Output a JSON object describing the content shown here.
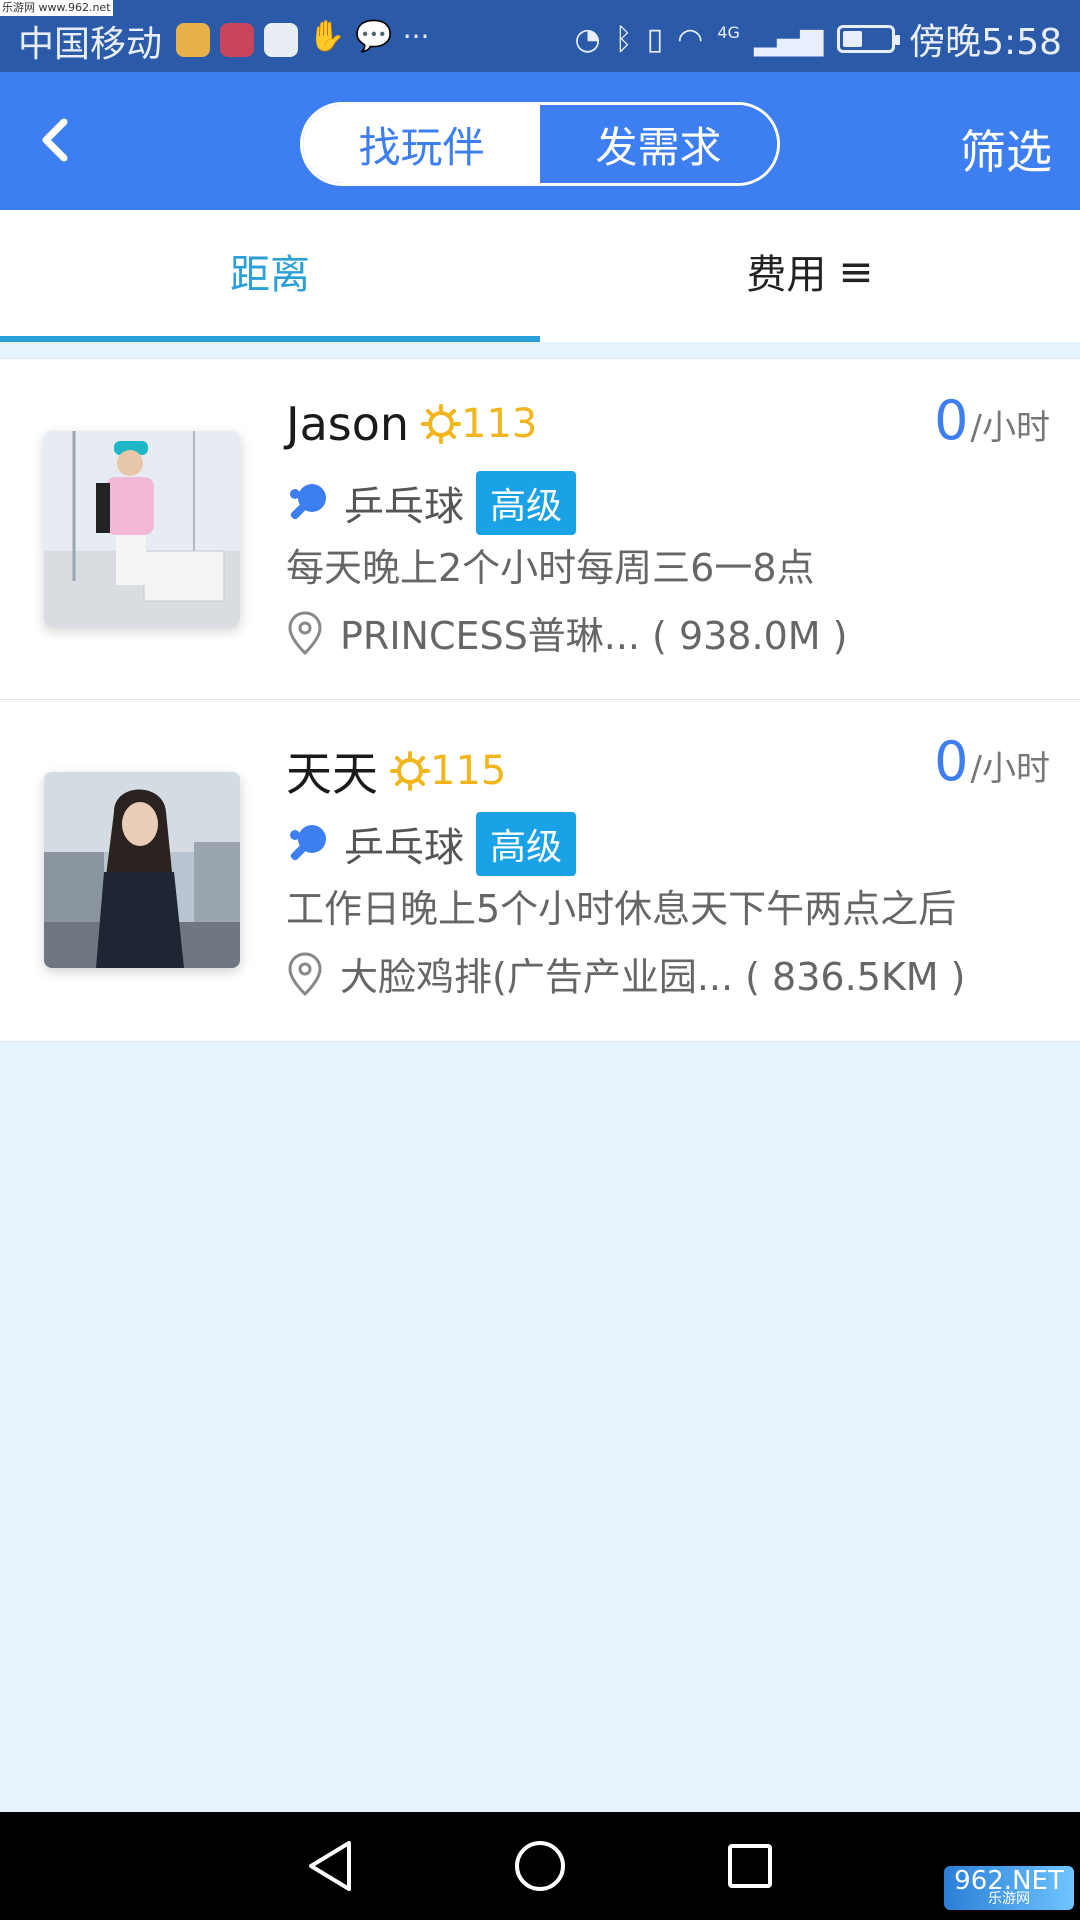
{
  "watermark_top": "乐游网 www.962.net",
  "status_bar": {
    "carrier": "中国移动",
    "more": "···",
    "time": "傍晚5:58",
    "network": "4G",
    "battery_level": 0.4
  },
  "header": {
    "tabs": [
      {
        "label": "找玩伴",
        "active": true
      },
      {
        "label": "发需求",
        "active": false
      }
    ],
    "filter_label": "筛选"
  },
  "sort_tabs": {
    "distance_label": "距离",
    "fee_label": "费用",
    "fee_icon": "≡"
  },
  "items": [
    {
      "name": "Jason",
      "level": "113",
      "price": "0",
      "price_unit": "/小时",
      "sport": "乒乓球",
      "skill": "高级",
      "description": "每天晚上2个小时每周三6一8点",
      "location": "PRINCESS普琳... ( 938.0M )"
    },
    {
      "name": "天天",
      "level": "115",
      "price": "0",
      "price_unit": "/小时",
      "sport": "乒乓球",
      "skill": "高级",
      "description": "工作日晚上5个小时休息天下午两点之后",
      "location": "大脸鸡排(广告产业园... ( 836.5KM )"
    }
  ],
  "watermark_logo": {
    "main": "962.NET",
    "sub": "乐游网"
  },
  "colors": {
    "primary": "#3d7ef0",
    "accent": "#2b9fd8",
    "badge": "#1aa2e6",
    "level": "#f2b51c"
  }
}
